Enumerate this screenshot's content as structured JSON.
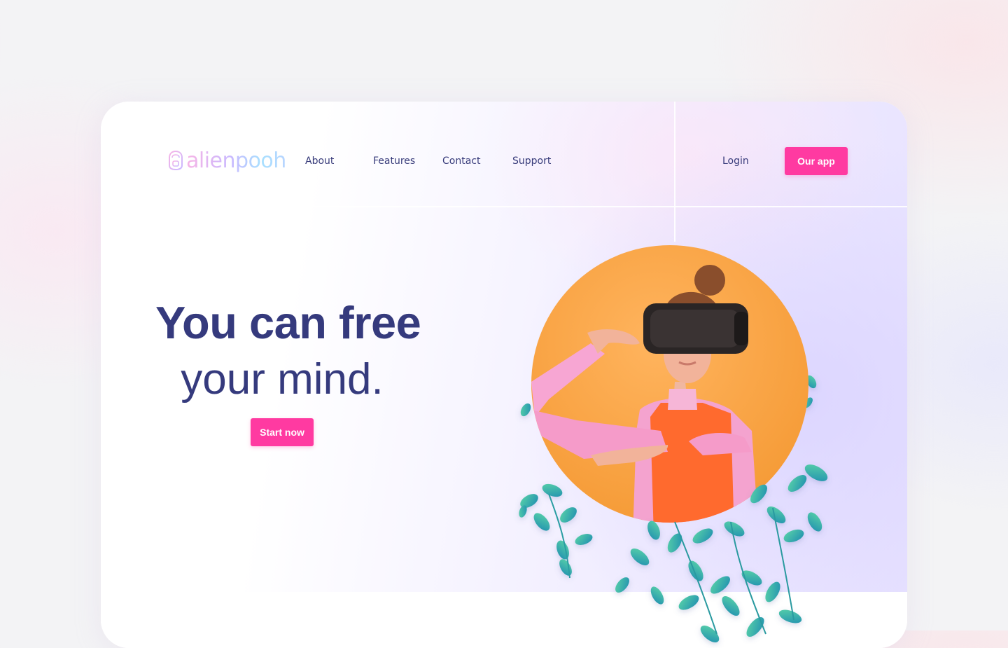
{
  "brand": {
    "name": "alienpooh"
  },
  "nav": {
    "links": [
      "About",
      "Features",
      "Contact",
      "Support"
    ],
    "login": "Login",
    "cta": "Our app"
  },
  "hero": {
    "headline_bold": "You can free",
    "headline_light": "your mind.",
    "cta": "Start now",
    "image": "woman-vr-headset-photo"
  },
  "colors": {
    "accent": "#ff3aa1",
    "text": "#353a7d",
    "photo_bg": "#f6a040",
    "leaf": "#2fb59a"
  }
}
